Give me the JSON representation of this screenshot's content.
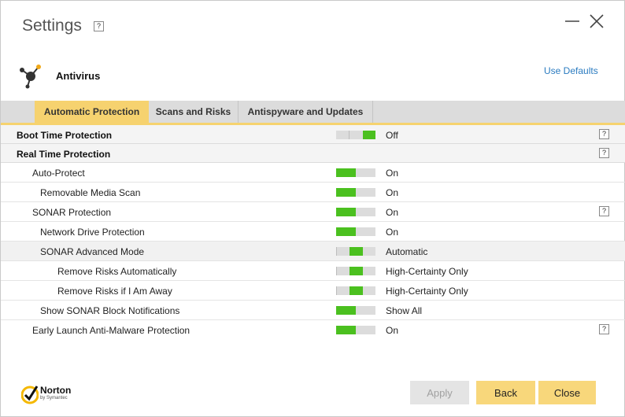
{
  "window": {
    "title": "Settings",
    "help_label": "?"
  },
  "section": {
    "title": "Antivirus",
    "use_defaults": "Use Defaults",
    "icon": "antivirus-molecule-icon"
  },
  "tabs": [
    {
      "label": "Automatic Protection",
      "active": true
    },
    {
      "label": "Scans and Risks",
      "active": false
    },
    {
      "label": "Antispyware and Updates",
      "active": false
    }
  ],
  "rows": [
    {
      "label": "Boot Time Protection",
      "status": "Off",
      "toggle": "off",
      "header": true,
      "help": "?"
    },
    {
      "label": "Real Time Protection",
      "status": "",
      "toggle": "none",
      "header": true,
      "help": "?"
    },
    {
      "label": "Auto-Protect",
      "status": "On",
      "toggle": "on"
    },
    {
      "label": "Removable Media Scan",
      "status": "On",
      "toggle": "on"
    },
    {
      "label": "SONAR Protection",
      "status": "On",
      "toggle": "on",
      "help": "?"
    },
    {
      "label": "Network Drive Protection",
      "status": "On",
      "toggle": "on"
    },
    {
      "label": "SONAR Advanced Mode",
      "status": "Automatic",
      "toggle": "auto"
    },
    {
      "label": "Remove Risks Automatically",
      "status": "High-Certainty Only",
      "toggle": "auto"
    },
    {
      "label": "Remove Risks if I Am Away",
      "status": "High-Certainty Only",
      "toggle": "auto"
    },
    {
      "label": "Show SONAR Block Notifications",
      "status": "Show All",
      "toggle": "on"
    },
    {
      "label": "Early Launch Anti-Malware Protection",
      "status": "On",
      "toggle": "on",
      "help": "?"
    }
  ],
  "footer": {
    "brand": "Norton",
    "brand_sub": "by Symantec",
    "apply_label": "Apply",
    "back_label": "Back",
    "close_label": "Close"
  },
  "colors": {
    "accent": "#f6d26f",
    "toggle_on": "#4bc01f",
    "link": "#2a7bc0"
  }
}
